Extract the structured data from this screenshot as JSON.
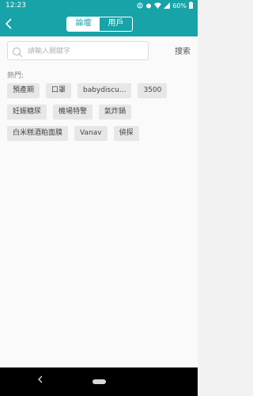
{
  "status_bar": {
    "time": "12:23",
    "battery": "60%",
    "icons": [
      "data-saver-icon",
      "alarm-icon",
      "wifi-icon",
      "signal-icon",
      "battery-icon"
    ]
  },
  "header": {
    "tabs": [
      {
        "label": "論壇",
        "active": true
      },
      {
        "label": "用戶",
        "active": false
      }
    ],
    "accent_color": "#17a3a8"
  },
  "search": {
    "placeholder": "請輸入關鍵字",
    "value": "",
    "button_label": "搜索"
  },
  "hot": {
    "label": "熱門:",
    "tags": [
      [
        "預產期",
        "口罩",
        "babydiscu...",
        "3500"
      ],
      [
        "妊娠糖尿",
        "機場特警",
        "氣炸鍋"
      ],
      [
        "白米糕酒粕面膜",
        "Vanav",
        "偵探"
      ]
    ]
  }
}
